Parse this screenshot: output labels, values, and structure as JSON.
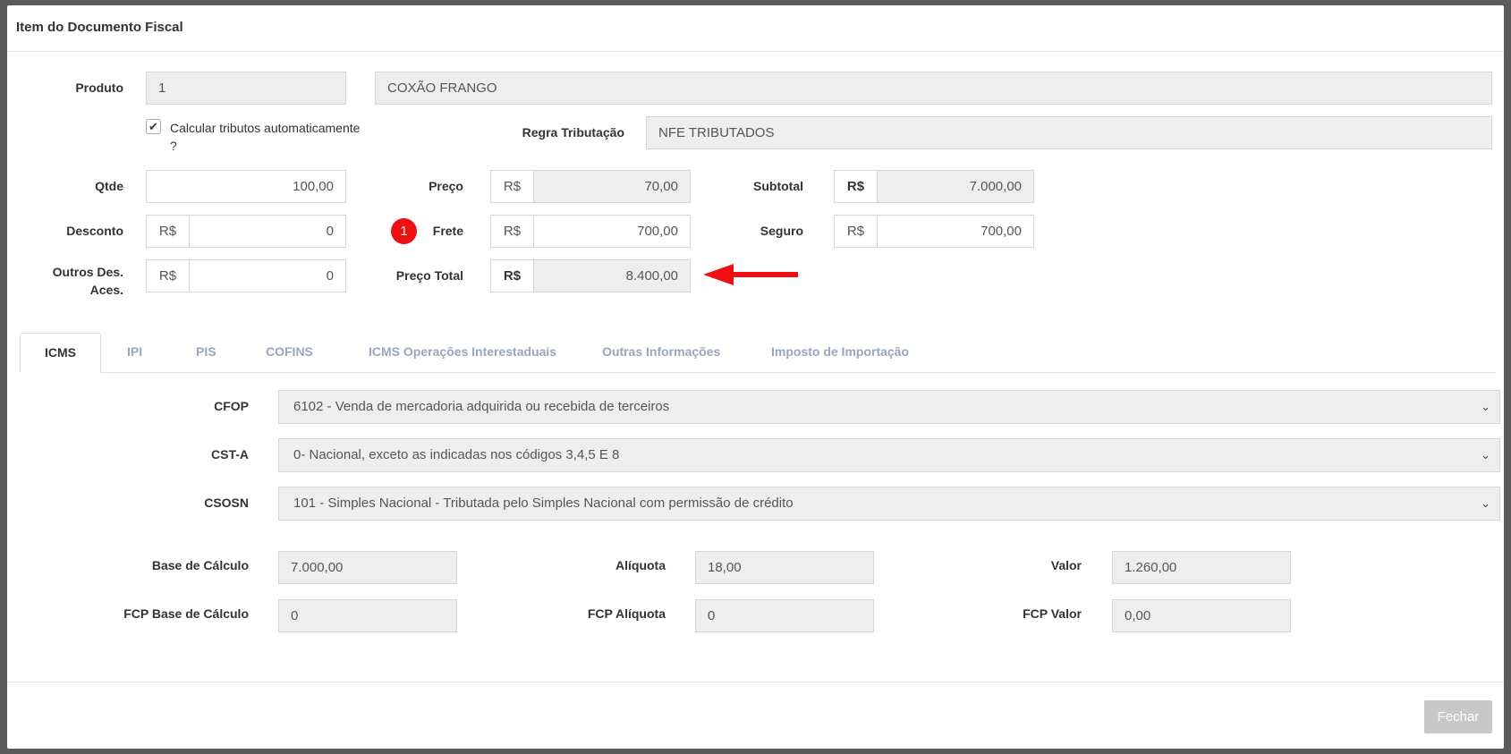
{
  "dialog": {
    "title": "Item do Documento Fiscal",
    "close_label": "Fechar"
  },
  "produto": {
    "label": "Produto",
    "code": "1",
    "name": "COXÃO FRANGO"
  },
  "calc": {
    "label": "Calcular tributos automaticamente",
    "label2": "?",
    "checked": true
  },
  "regra": {
    "label": "Regra Tributação",
    "value": "NFE TRIBUTADOS"
  },
  "qtde": {
    "label": "Qtde",
    "value": "100,00"
  },
  "preco": {
    "label": "Preço",
    "currency": "R$",
    "value": "70,00"
  },
  "subtotal": {
    "label": "Subtotal",
    "currency": "R$",
    "value": "7.000,00"
  },
  "desconto": {
    "label": "Desconto",
    "currency": "R$",
    "value": "0"
  },
  "frete": {
    "label": "Frete",
    "currency": "R$",
    "value": "700,00",
    "badge": "1"
  },
  "seguro": {
    "label": "Seguro",
    "currency": "R$",
    "value": "700,00"
  },
  "outros": {
    "label": "Outros Des.",
    "label2": "Aces.",
    "currency": "R$",
    "value": "0"
  },
  "preco_total": {
    "label": "Preço Total",
    "currency": "R$",
    "value": "8.400,00"
  },
  "tabs": [
    "ICMS",
    "IPI",
    "PIS",
    "COFINS",
    "ICMS Operações Interestaduais",
    "Outras Informações",
    "Imposto de Importação"
  ],
  "icms": {
    "cfop": {
      "label": "CFOP",
      "value": "6102 - Venda de mercadoria adquirida ou recebida de terceiros"
    },
    "csta": {
      "label": "CST-A",
      "value": "0- Nacional, exceto as indicadas nos códigos 3,4,5 E 8"
    },
    "csosn": {
      "label": "CSOSN",
      "value": "101 - Simples Nacional - Tributada pelo Simples Nacional com permissão de crédito"
    },
    "base": {
      "label": "Base de Cálculo",
      "value": "7.000,00"
    },
    "aliquota": {
      "label": "Alíquota",
      "value": "18,00"
    },
    "valor": {
      "label": "Valor",
      "value": "1.260,00"
    },
    "fcp_base": {
      "label": "FCP Base de Cálculo",
      "value": "0"
    },
    "fcp_aliquota": {
      "label": "FCP Alíquota",
      "value": "0"
    },
    "fcp_valor": {
      "label": "FCP Valor",
      "value": "0,00"
    }
  },
  "colors": {
    "annotation": "#ee1111",
    "tab_inactive": "#98a6ba",
    "readonly_bg": "#eeeeee"
  },
  "icons": {
    "checkbox": "check-icon",
    "select": "chevron-down-icon",
    "annotation": "arrow-left-icon"
  }
}
